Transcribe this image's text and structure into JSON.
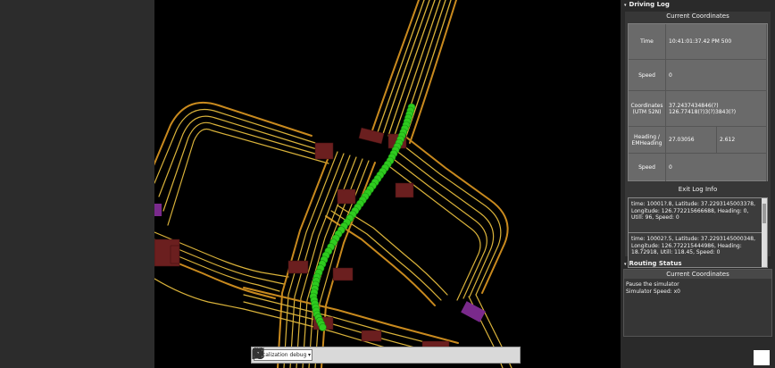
{
  "toolbar": {
    "mode_select": "Localization debug",
    "icons": [
      "map-icon",
      "car-view-icon",
      "car-follow-icon",
      "reset-rotation-icon",
      "step-back-icon",
      "play-icon",
      "rewind-icon",
      "pause-icon",
      "map-layer-icon",
      "location-icon"
    ]
  },
  "driving_log": {
    "title": "Driving Log",
    "state_title": "Current Coordinates",
    "rows": [
      {
        "key": "Time",
        "value": "10:41:01:37.42 PM 500",
        "value2": ""
      },
      {
        "key": "Speed",
        "value": "0",
        "value2": ""
      },
      {
        "key": "Coordinates (UTM 52N)",
        "value": "37.2437434846(?)",
        "value2": "126.77418(?)3(?)3843(?)"
      },
      {
        "key": "Heading / EMHeading",
        "value": "27.03056",
        "value2": "2.612"
      },
      {
        "key": "Speed",
        "value": "0",
        "value2": ""
      }
    ],
    "exit_title": "Exit Log Info",
    "exit_items": [
      "time: 10001?.8, Latitude: 37.2293145003378, Longitude: 126.772215666688, Heading: 0, Utill: 96, Speed: 0",
      "time: 10002?.5, Latitude: 37.2293145000348, Longitude: 126.772215444986, Heading: 18.72918, Utill: 118.45, Speed: 0"
    ]
  },
  "routing": {
    "title": "Routing Status",
    "sub_title": "Current Coordinates",
    "lines": [
      "Pause the simulator",
      "Simulator Speed: x0"
    ]
  },
  "colors": {
    "road_line": "#d9b23a",
    "road_edge": "#c98a1e",
    "crosswalk": "#6b1f1f",
    "path_dots": "#2ecc1f",
    "purple": "#7a2a8c"
  }
}
